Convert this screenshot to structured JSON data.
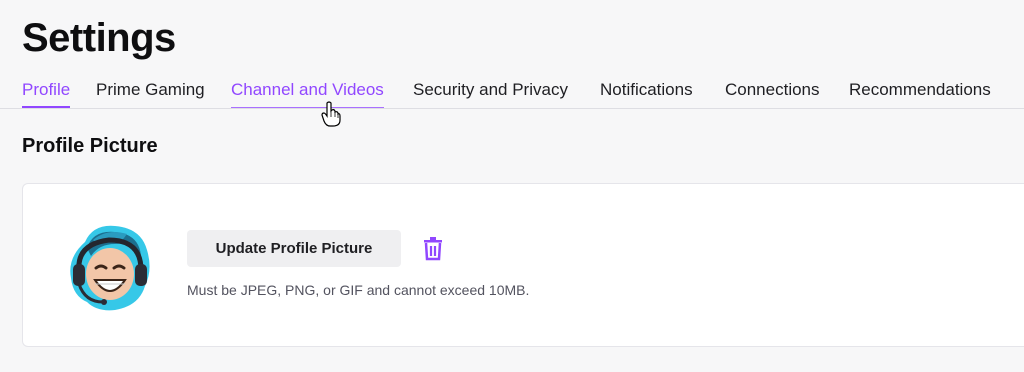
{
  "page": {
    "title": "Settings"
  },
  "tabs": [
    {
      "label": "Profile",
      "state": "active"
    },
    {
      "label": "Prime Gaming",
      "state": "normal"
    },
    {
      "label": "Channel and Videos",
      "state": "hover"
    },
    {
      "label": "Security and Privacy",
      "state": "normal"
    },
    {
      "label": "Notifications",
      "state": "normal"
    },
    {
      "label": "Connections",
      "state": "normal"
    },
    {
      "label": "Recommendations",
      "state": "normal"
    }
  ],
  "profile_picture": {
    "section_title": "Profile Picture",
    "update_label": "Update Profile Picture",
    "delete_icon": "trash-icon",
    "hint": "Must be JPEG, PNG, or GIF and cannot exceed 10MB."
  },
  "colors": {
    "accent": "#9147ff",
    "background": "#f7f7f8",
    "card": "#ffffff",
    "button": "#efeff1"
  }
}
